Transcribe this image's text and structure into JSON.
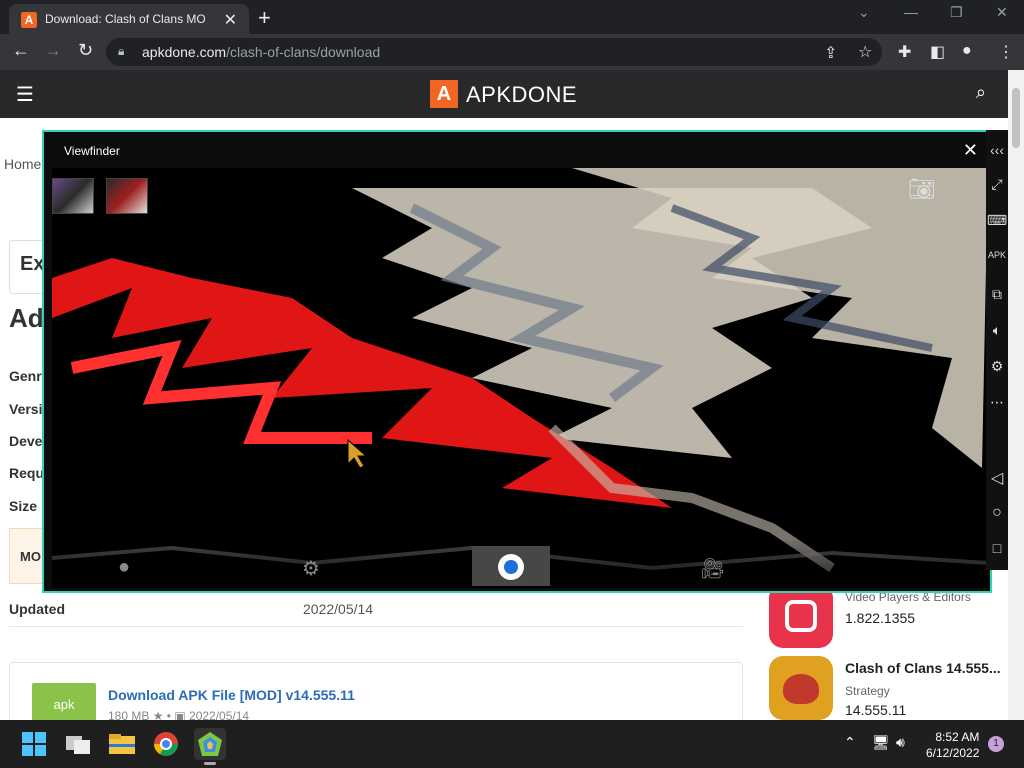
{
  "browser": {
    "tab_title": "Download: Clash of Clans MOD APK",
    "tab_favicon": "A",
    "new_tab_label": "+",
    "url_domain": "apkdone.com",
    "url_path": "/clash-of-clans/download"
  },
  "site": {
    "logo_mark": "A",
    "logo_text": "APKDONE",
    "breadcrumb_home": "Home",
    "search_box_partial": "Ex",
    "heading_partial": "Ad",
    "rows": [
      "Genr",
      "Versi",
      "Deve",
      "Requ",
      "Size"
    ],
    "mod_partial": "MO",
    "updated_label": "Updated",
    "updated_value": "2022/05/14",
    "download": {
      "badge": "apk",
      "link_text": "Download APK File [MOD] v14.555.11",
      "size": "180 MB",
      "date": "2022/05/14"
    },
    "sidebar": [
      {
        "category": "Video Players & Editors",
        "version": "1.822.1355",
        "color": "#e8334a"
      },
      {
        "title": "Clash of Clans 14.555...",
        "category": "Strategy",
        "version": "14.555.11",
        "color": "#e0a020"
      }
    ]
  },
  "viewfinder": {
    "title": "Viewfinder",
    "close_label": "✕"
  },
  "taskbar": {
    "time": "8:52 AM",
    "date": "6/12/2022",
    "notification_count": "1"
  }
}
